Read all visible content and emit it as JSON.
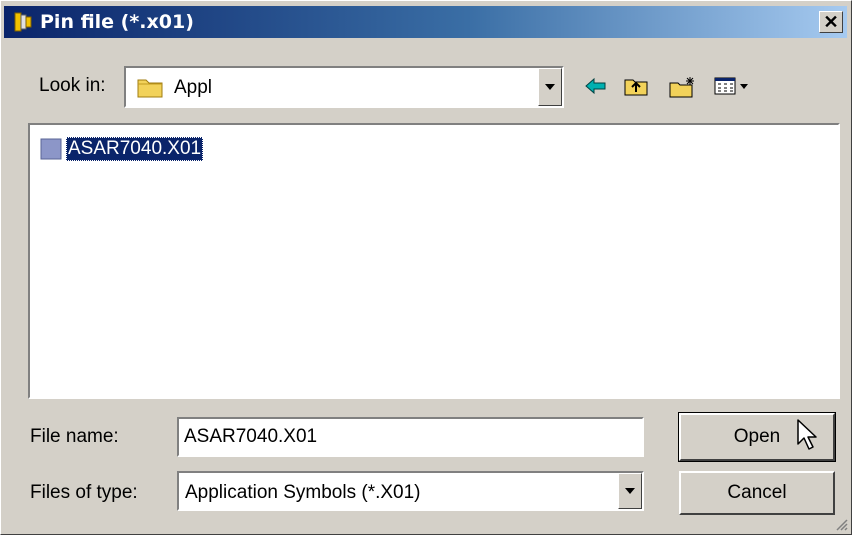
{
  "window": {
    "title": "Pin file (*.x01)",
    "close_label": "✕"
  },
  "lookin": {
    "label": "Look in:",
    "value": "Appl"
  },
  "toolbar": [
    "back-icon",
    "up-folder-icon",
    "new-folder-icon",
    "view-menu-icon"
  ],
  "files": [
    {
      "name": "ASAR7040.X01",
      "selected": true
    }
  ],
  "filename": {
    "label": "File name:",
    "value": "ASAR7040.X01"
  },
  "filetype": {
    "label": "Files of type:",
    "value": "Application Symbols (*.X01)"
  },
  "buttons": {
    "open": "Open",
    "cancel": "Cancel"
  },
  "colors": {
    "titlebar": "#0a246a",
    "selection": "#0a246a",
    "face": "#d4d0c8",
    "arrow": "#00a0a0",
    "folder": "#f2d25a"
  }
}
